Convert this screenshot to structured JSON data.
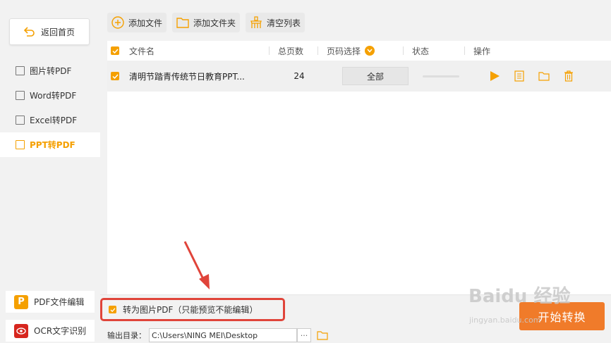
{
  "sidebar": {
    "back_label": "返回首页",
    "items": [
      {
        "label": "图片转PDF",
        "active": false
      },
      {
        "label": "Word转PDF",
        "active": false
      },
      {
        "label": "Excel转PDF",
        "active": false
      },
      {
        "label": "PPT转PDF",
        "active": true
      }
    ],
    "tools": [
      {
        "label": "PDF文件编辑",
        "icon": "P",
        "color": "#f5a000"
      },
      {
        "label": "OCR文字识别",
        "icon": "eye",
        "color": "#d7261e"
      }
    ]
  },
  "toolbar": {
    "add_file": "添加文件",
    "add_folder": "添加文件夹",
    "clear_list": "清空列表"
  },
  "table": {
    "headers": {
      "filename": "文件名",
      "pages": "总页数",
      "page_select": "页码选择",
      "status": "状态",
      "actions": "操作"
    },
    "rows": [
      {
        "filename": "清明节踏青传统节日教育PPT...",
        "pages": "24",
        "page_select": "全部"
      }
    ]
  },
  "bottom": {
    "convert_image_option": "转为图片PDF（只能预览不能编辑）",
    "output_label": "输出目录：",
    "output_path": "C:\\Users\\NING MEI\\Desktop",
    "more": "···",
    "start_button": "开始转换"
  },
  "watermark": {
    "brand": "Baidu 经验",
    "url": "jingyan.baidu.com"
  },
  "colors": {
    "accent": "#f5a000",
    "start": "#f07b2a",
    "highlight": "#e0443a"
  }
}
